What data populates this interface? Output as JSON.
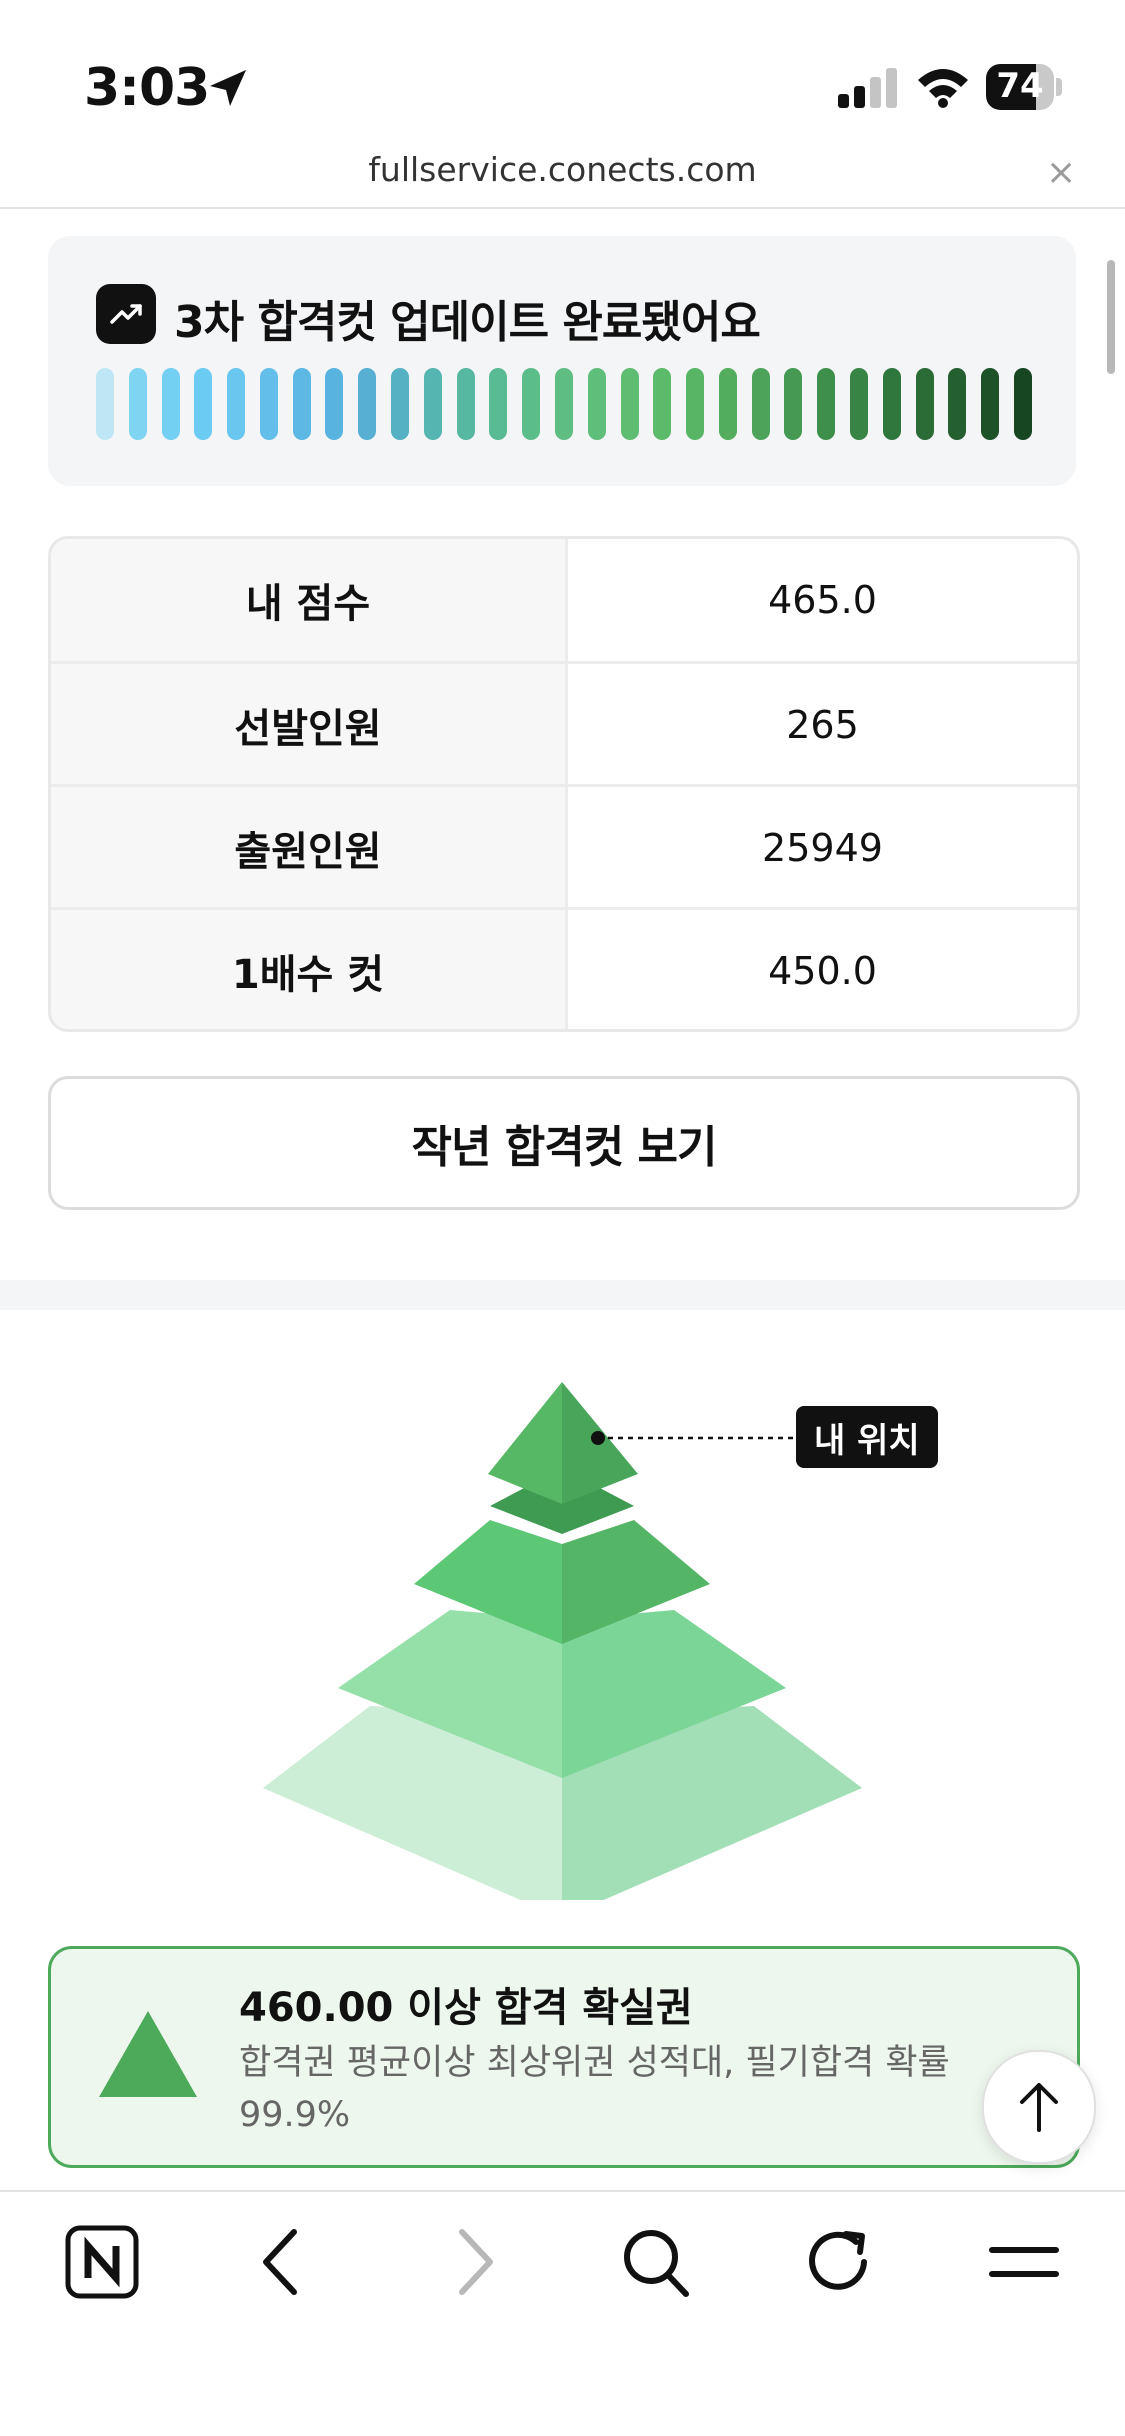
{
  "status_bar": {
    "time": "3:03",
    "battery": "74",
    "battery_level": 0.74
  },
  "browser": {
    "url": "fullservice.conects.com",
    "close_label": "×"
  },
  "update_card": {
    "title": "3차 합격컷 업데이트 완료됐어요",
    "bar_colors": [
      "#bfe6f5",
      "#7fd4f2",
      "#74d0f3",
      "#6ccbf2",
      "#68c6ef",
      "#63bfea",
      "#5db8e6",
      "#58b3e0",
      "#57b0d3",
      "#56b2c2",
      "#55b5b0",
      "#56b8a0",
      "#58bb94",
      "#5bbd8a",
      "#5ebe82",
      "#5fbe7a",
      "#5fbd72",
      "#5cba6b",
      "#58b566",
      "#52ad5f",
      "#4ca359",
      "#459953",
      "#3f8f4c",
      "#388445",
      "#30773d",
      "#2a6b36",
      "#235f2f",
      "#1d5229",
      "#174623"
    ]
  },
  "score_table": {
    "rows": [
      {
        "label": "내 점수",
        "value": "465.0"
      },
      {
        "label": "선발인원",
        "value": "265"
      },
      {
        "label": "출원인원",
        "value": "25949"
      },
      {
        "label": "1배수 컷",
        "value": "450.0"
      }
    ]
  },
  "prev_year_button": "작년 합격컷 보기",
  "pyramid": {
    "my_position_label": "내 위치",
    "colors": {
      "top": "#4fae5f",
      "tier2": "#5cc774",
      "tier3": "#95dfa9",
      "base": "#cdeed6"
    }
  },
  "result": {
    "title": "460.00 이상 합격 확실권",
    "description": "합격권 평균이상 최상위권 성적대, 필기합격 확률 99.9%",
    "accent": "#4daa5a"
  }
}
